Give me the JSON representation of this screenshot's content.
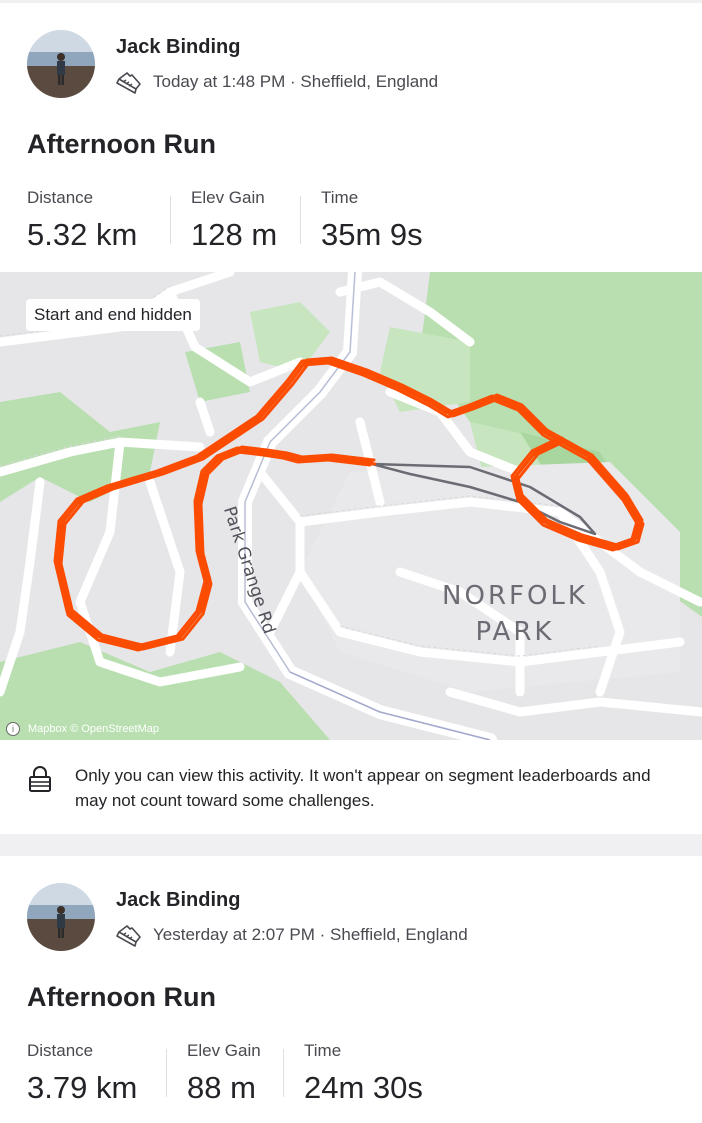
{
  "activities": [
    {
      "athlete": "Jack Binding",
      "meta": "Today at 1:48 PM · Sheffield, England",
      "title": "Afternoon Run",
      "stats": [
        {
          "label": "Distance",
          "value": "5.32 km"
        },
        {
          "label": "Elev Gain",
          "value": "128 m"
        },
        {
          "label": "Time",
          "value": "35m 9s"
        }
      ],
      "map": {
        "badge": "Start and end hidden",
        "attribution": "Mapbox © OpenStreetMap",
        "park_label_line1": "NORFOLK",
        "park_label_line2": "PARK",
        "road_label": "Park Grange Rd",
        "route_color": "#fc4c02"
      },
      "privacy_notice": "Only you can view this activity. It won't appear on segment leaderboards and may not count toward some challenges."
    },
    {
      "athlete": "Jack Binding",
      "meta": "Yesterday at 2:07 PM · Sheffield, England",
      "title": "Afternoon Run",
      "stats": [
        {
          "label": "Distance",
          "value": "3.79 km"
        },
        {
          "label": "Elev Gain",
          "value": "88 m"
        },
        {
          "label": "Time",
          "value": "24m 30s"
        }
      ]
    }
  ],
  "icons": {
    "activity_type": "running-shoe-icon",
    "privacy": "lock-icon",
    "map_info": "info-icon"
  }
}
